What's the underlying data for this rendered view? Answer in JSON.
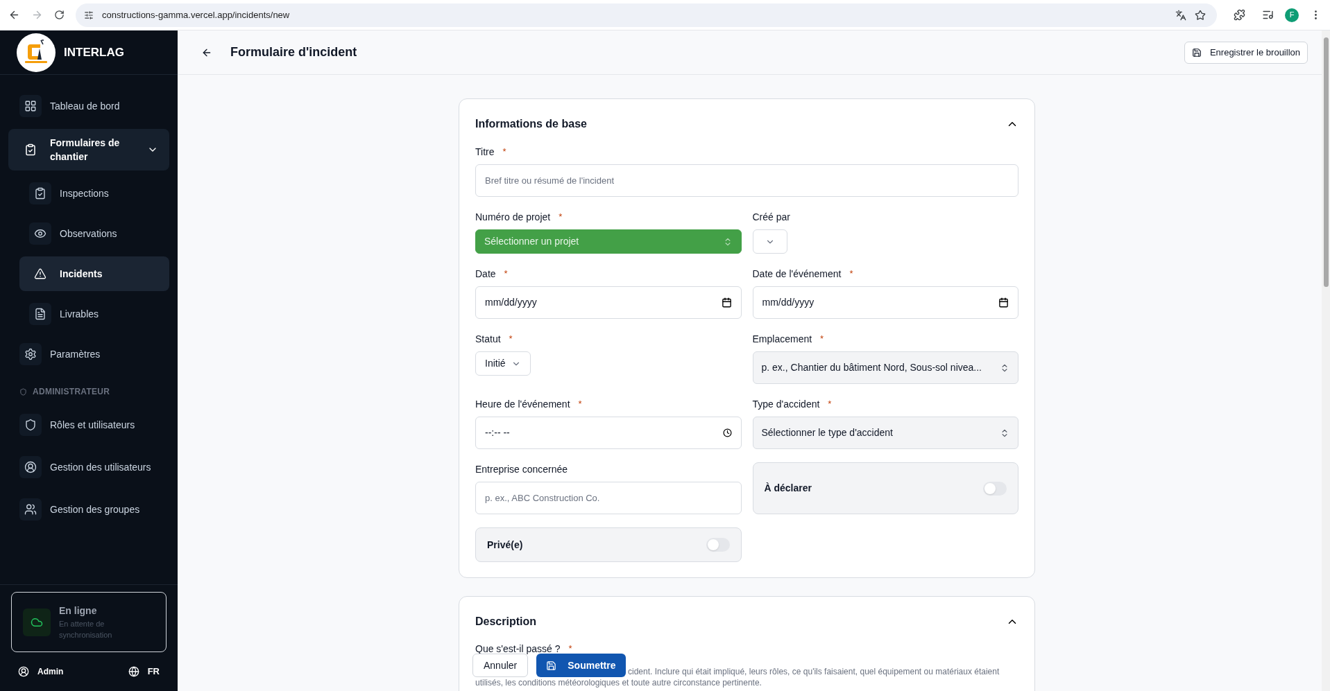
{
  "browser": {
    "url": "constructions-gamma.vercel.app/incidents/new",
    "profile": "F"
  },
  "sidebar": {
    "brand": "INTERLAG",
    "nav": [
      {
        "label": "Tableau de bord",
        "selected": false
      },
      {
        "label": "Formulaires de chantier",
        "selected": false,
        "expanded": true,
        "children": [
          {
            "label": "Inspections",
            "selected": false
          },
          {
            "label": "Observations",
            "selected": false
          },
          {
            "label": "Incidents",
            "selected": true
          },
          {
            "label": "Livrables",
            "selected": false
          }
        ]
      },
      {
        "label": "Paramètres",
        "selected": false
      }
    ],
    "admin_heading": "ADMINISTRATEUR",
    "admin_nav": [
      {
        "label": "Rôles et utilisateurs",
        "selected": false
      },
      {
        "label": "Gestion des utilisateurs",
        "selected": false
      },
      {
        "label": "Gestion des groupes",
        "selected": false
      }
    ],
    "status_card": {
      "title": "En ligne",
      "subtitle": "En attente de synchronisation"
    },
    "user": "Admin",
    "language": "FR"
  },
  "header": {
    "title": "Formulaire d'incident",
    "save_button": "Enregistrer le brouillon"
  },
  "sections": [
    {
      "title": "Informations de base",
      "expanded": true,
      "rows": [
        [
          {
            "kind": "text",
            "label": "Titre",
            "required_mark": "*",
            "placeholder": "Bref titre ou résumé de l'incident"
          }
        ],
        [
          {
            "kind": "select",
            "label": "Numéro de projet",
            "required_mark": "*",
            "placeholder": "Sélectionner un projet",
            "highlighted": true
          },
          {
            "kind": "dropdown",
            "label": "Créé par"
          }
        ],
        [
          {
            "kind": "date",
            "label": "Date",
            "required_mark": "*",
            "placeholder": "mm/dd/yyyy"
          },
          {
            "kind": "date",
            "label": "Date de l'événement",
            "required_mark": "*",
            "placeholder": "mm/dd/yyyy"
          }
        ],
        [
          {
            "kind": "dropdown",
            "label": "Statut",
            "required_mark": "*",
            "value": "Initié"
          },
          {
            "kind": "select",
            "label": "Emplacement",
            "required_mark": "*",
            "placeholder": "p. ex., Chantier du bâtiment Nord, Sous-sol nivea...",
            "highlighted": false
          }
        ],
        [
          {
            "kind": "time",
            "label": "Heure de l'événement",
            "required_mark": "*",
            "placeholder": "--:-- --"
          },
          {
            "kind": "select",
            "label": "Type d'accident",
            "required_mark": "*",
            "placeholder": "Sélectionner le type d'accident",
            "highlighted": false
          }
        ],
        [
          {
            "kind": "text",
            "label": "Entreprise concernée",
            "placeholder": "p. ex., ABC Construction Co."
          },
          {
            "kind": "toggle",
            "label": "À déclarer",
            "on": false
          }
        ],
        [
          {
            "kind": "toggle",
            "label": "Privé(e)",
            "on": false
          }
        ]
      ]
    },
    {
      "title": "Description",
      "expanded": true,
      "question": {
        "label": "Que s'est-il passé ?",
        "required_mark": "*",
        "hint_lines": [
          "cident. Inclure qui était impliqué, leurs rôles, ce qu'ils faisaient, quel équipement ou matériaux étaient",
          "utilisés, les conditions météorologiques et toute autre circonstance pertinente."
        ]
      }
    }
  ],
  "actions": {
    "cancel": "Annuler",
    "submit": "Soumettre"
  }
}
